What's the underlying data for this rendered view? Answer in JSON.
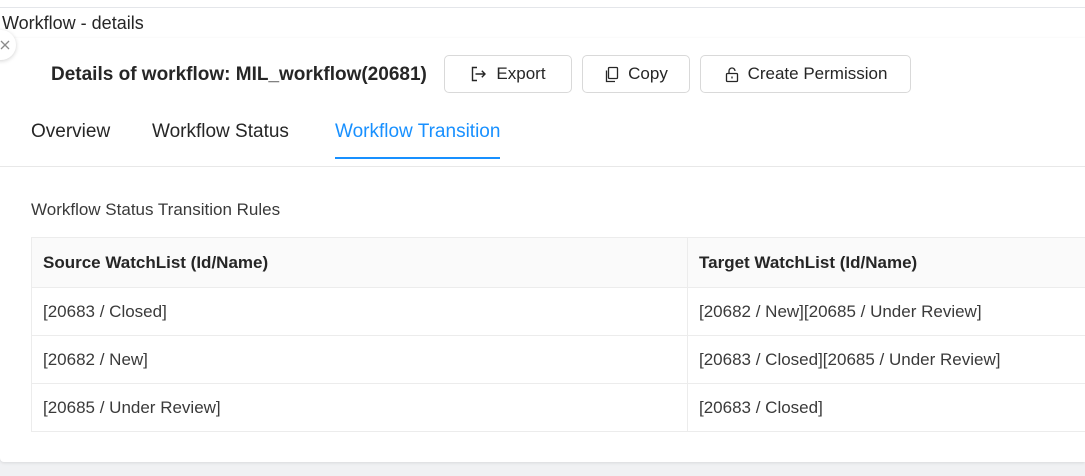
{
  "window": {
    "title": "Workflow - details"
  },
  "header": {
    "heading": "Details of workflow: MIL_workflow(20681)",
    "buttons": {
      "export": "Export",
      "copy": "Copy",
      "create_permission": "Create Permission"
    }
  },
  "tabs": [
    {
      "label": "Overview",
      "active": false
    },
    {
      "label": "Workflow Status",
      "active": false
    },
    {
      "label": "Workflow Transition",
      "active": true
    }
  ],
  "section": {
    "title": "Workflow Status Transition Rules"
  },
  "table": {
    "columns": [
      "Source WatchList (Id/Name)",
      "Target WatchList (Id/Name)"
    ],
    "rows": [
      [
        "[20683 / Closed]",
        "[20682 / New][20685 / Under Review]"
      ],
      [
        "[20682 / New]",
        "[20683 / Closed][20685 / Under Review]"
      ],
      [
        "[20685 / Under Review]",
        "[20683 / Closed]"
      ]
    ]
  },
  "colors": {
    "accent": "#1890ff",
    "text": "#262626",
    "border": "#d9d9d9",
    "background": "#f0f1f3"
  },
  "icons": [
    "close-icon",
    "export-icon",
    "copy-icon",
    "lock-icon"
  ]
}
